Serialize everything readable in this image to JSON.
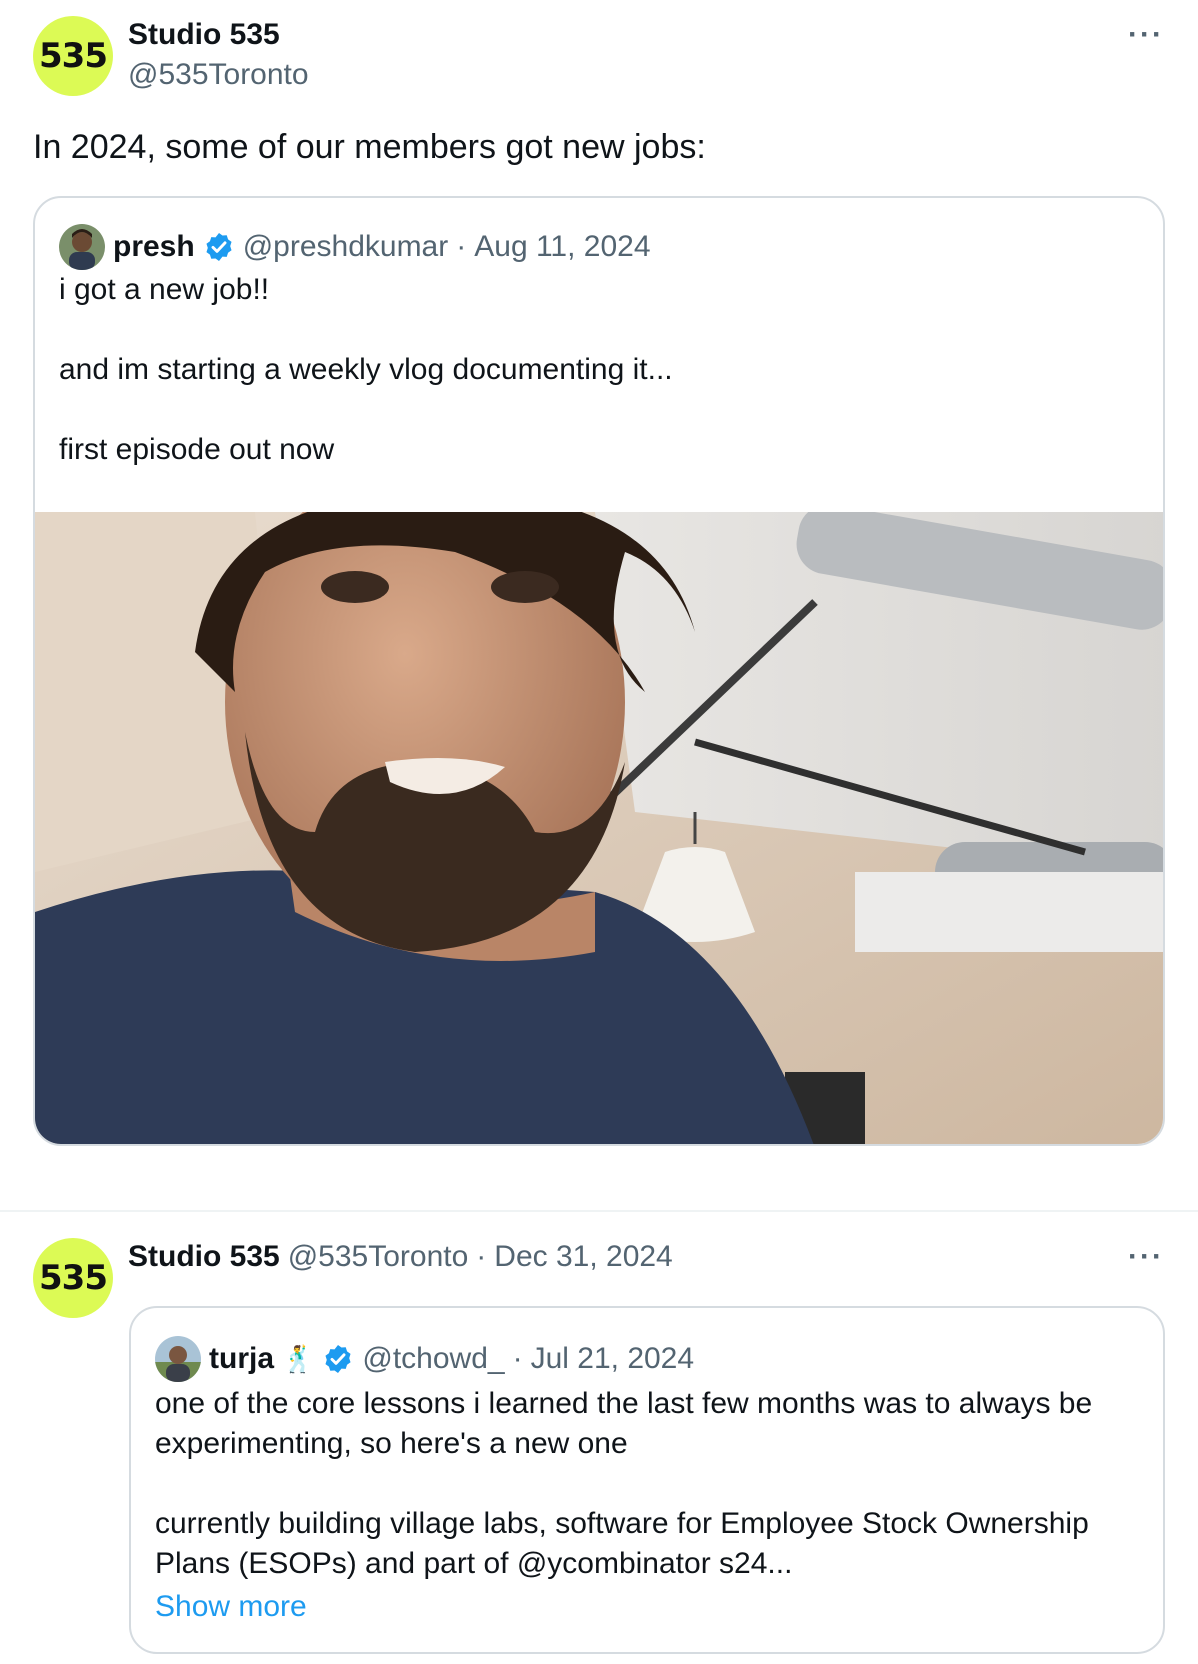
{
  "post1": {
    "avatar_text": "535",
    "display_name": "Studio 535",
    "handle": "@535Toronto",
    "more_label": "···",
    "text": "In 2024, some of our members got new jobs:",
    "quote": {
      "display_name": "presh",
      "handle": "@preshdkumar",
      "separator": "·",
      "date": "Aug 11, 2024",
      "text": "i got a new job!!\n\nand im starting a weekly vlog documenting it...\n\nfirst episode out now"
    }
  },
  "post2": {
    "avatar_text": "535",
    "display_name": "Studio 535",
    "handle": "@535Toronto",
    "separator": "·",
    "date": "Dec 31, 2024",
    "more_label": "···",
    "quote": {
      "display_name": "turja",
      "name_emoji": "🕺",
      "handle": "@tchowd_",
      "separator": "·",
      "date": "Jul 21, 2024",
      "text": "one of the core lessons i learned the last few months was to always be experimenting, so here's a new one\n\ncurrently building village labs, software for Employee Stock Ownership Plans (ESOPs) and part of @ycombinator s24...",
      "show_more": "Show more"
    }
  },
  "colors": {
    "brand_avatar": "#dcfa55",
    "verified": "#1d9bf0",
    "link": "#1d9bf0",
    "secondary_text": "#536471"
  }
}
